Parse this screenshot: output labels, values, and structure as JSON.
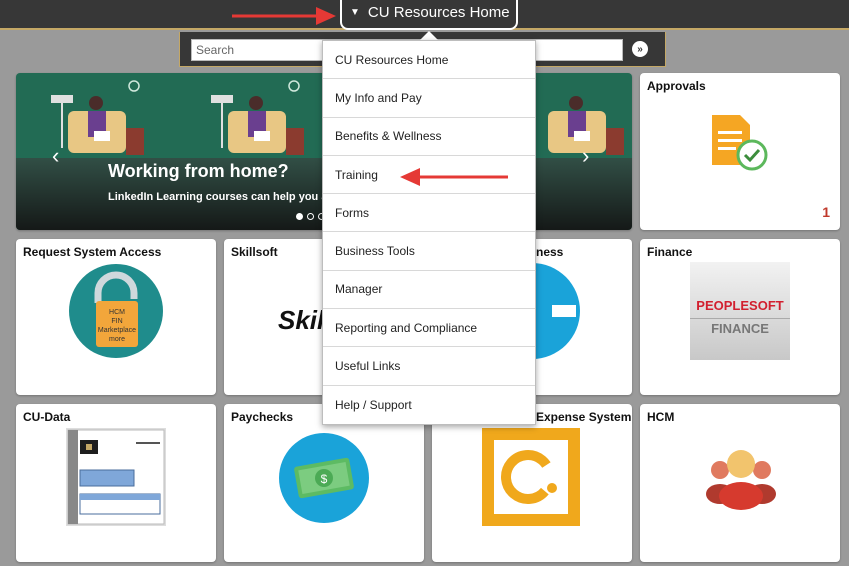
{
  "header": {
    "home_label": "CU Resources Home"
  },
  "search": {
    "placeholder": "Search"
  },
  "banner": {
    "headline": "Working from home?",
    "subtext": "LinkedIn Learning courses can help you adj",
    "slides_total": 3,
    "slide_active": 1
  },
  "menu": {
    "items": [
      {
        "label": "CU Resources Home"
      },
      {
        "label": "My Info and Pay"
      },
      {
        "label": "Benefits & Wellness"
      },
      {
        "label": "Training"
      },
      {
        "label": "Forms"
      },
      {
        "label": "Business Tools"
      },
      {
        "label": "Manager"
      },
      {
        "label": "Reporting and Compliance"
      },
      {
        "label": "Useful Links"
      },
      {
        "label": "Help / Support"
      }
    ]
  },
  "tiles": {
    "approvals": {
      "title": "Approvals",
      "count": "1"
    },
    "request_access": {
      "title": "Request System Access",
      "lock_lines": [
        "HCM",
        "FIN",
        "Marketplace",
        "more"
      ]
    },
    "skillsoft": {
      "title": "Skillsoft",
      "logo": "Skil"
    },
    "wellness": {
      "title": "ness"
    },
    "finance": {
      "title": "Finance",
      "logo_line1": "PEOPLESOFT",
      "logo_line2": "FINANCE"
    },
    "cu_data": {
      "title": "CU-Data"
    },
    "paychecks": {
      "title": "Paychecks",
      "icon": "$"
    },
    "expense": {
      "title": "Expense System"
    },
    "hcm": {
      "title": "HCM"
    }
  },
  "colors": {
    "topbar": "#373737",
    "gold": "#c4a866",
    "accent_red": "#e53935",
    "teal": "#1f8c8c"
  }
}
